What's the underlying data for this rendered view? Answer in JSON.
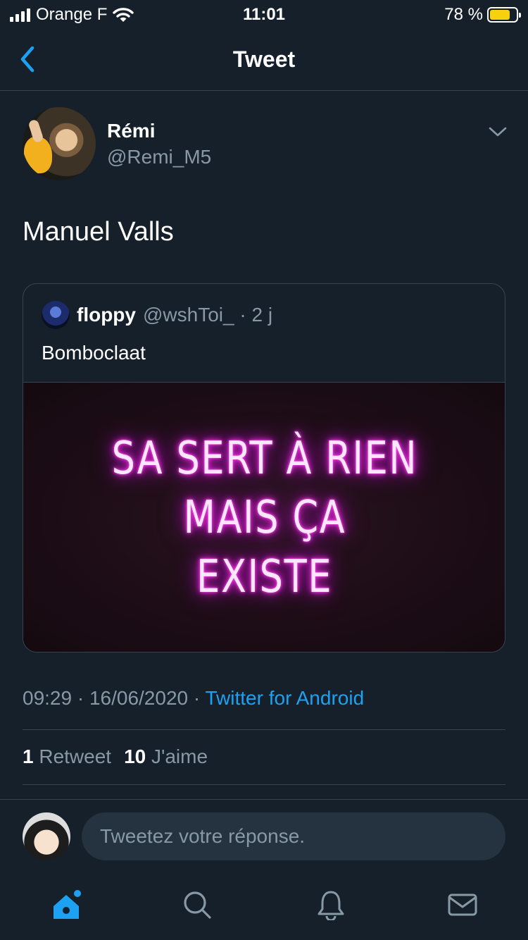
{
  "status_bar": {
    "carrier": "Orange F",
    "time": "11:01",
    "battery": "78 %",
    "battery_level": 0.78
  },
  "nav": {
    "title": "Tweet"
  },
  "tweet": {
    "author_name": "Rémi",
    "author_handle": "@Remi_M5",
    "text": "Manuel Valls",
    "timestamp": "09:29 · 16/06/2020 ·",
    "source": "Twitter for Android",
    "retweets_count": "1",
    "retweets_label": "Retweet",
    "likes_count": "10",
    "likes_label": "J'aime"
  },
  "quoted_tweet": {
    "name": "floppy",
    "handle": "@wshToi_ · 2 j",
    "text": "Bomboclaat",
    "image_text_line1": "SA SERT À RIEN MAIS ÇA",
    "image_text_line2": "EXISTE"
  },
  "reply": {
    "placeholder": "Tweetez votre réponse."
  },
  "tabbar": {
    "tabs": [
      "home-icon",
      "search-icon",
      "notifications-icon",
      "messages-icon"
    ]
  },
  "colors": {
    "background": "#15202b",
    "accent": "#1da1f2",
    "secondary_text": "#8899a6",
    "border": "#38444d"
  }
}
